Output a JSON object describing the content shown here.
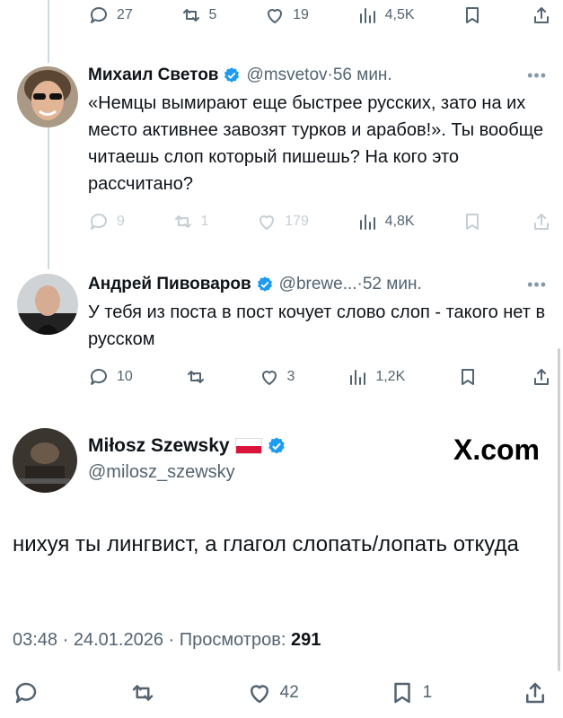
{
  "top_actions": {
    "replies": "27",
    "reposts": "5",
    "likes": "19",
    "views": "4,5K"
  },
  "replies": [
    {
      "name": "Михаил Светов",
      "handle": "@msvetov",
      "time": "56 мин.",
      "text": "«Немцы вымирают еще быстрее русских, зато на их место активнее завозят турков и арабов!». Ты вообще читаешь слоп который пишешь? На кого это рассчитано?",
      "actions": {
        "replies": "9",
        "reposts": "1",
        "likes": "179",
        "views": "4,8K"
      }
    },
    {
      "name": "Андрей Пивоваров",
      "handle": "@brewe...",
      "time": "52 мин.",
      "text": "У тебя из поста в пост кочует слово слоп - такого нет в русском",
      "actions": {
        "replies": "10",
        "reposts": "",
        "likes": "3",
        "views": "1,2K"
      }
    }
  ],
  "main_post": {
    "name": "Miłosz Szewsky",
    "handle": "@milosz_szewsky",
    "watermark": "X.com",
    "text": "нихуя ты лингвист, а глагол слопать/лопать откуда",
    "time": "03:48",
    "date": "24.01.2026",
    "views_label": "Просмотров:",
    "views": "291",
    "actions": {
      "replies": "",
      "reposts": "",
      "likes": "42",
      "bookmarks": "1"
    }
  },
  "colors": {
    "verified": "#1d9bf0",
    "secondary_text": "#536471"
  }
}
